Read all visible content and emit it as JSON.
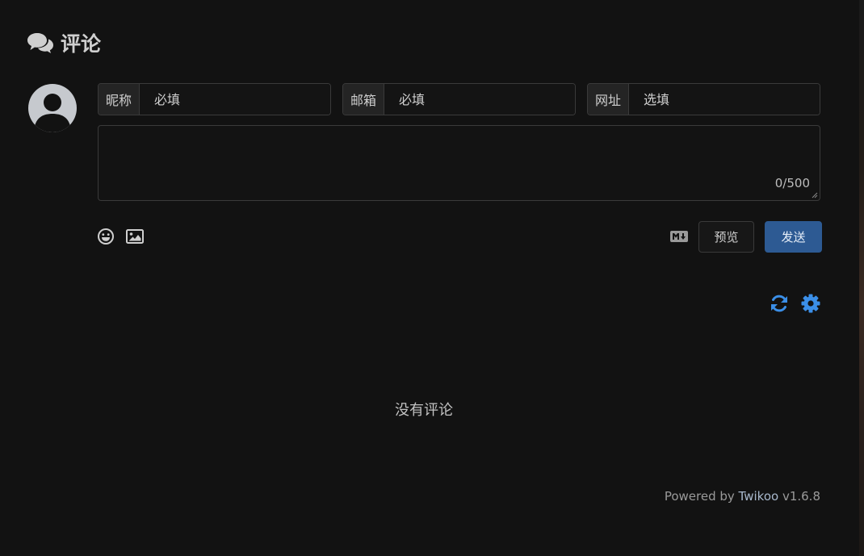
{
  "header": {
    "title": "评论",
    "icon": "comments-icon"
  },
  "form": {
    "nick": {
      "label": "昵称",
      "placeholder": "必填"
    },
    "mail": {
      "label": "邮箱",
      "placeholder": "必填"
    },
    "link": {
      "label": "网址",
      "placeholder": "选填"
    },
    "textarea": {
      "value": "",
      "counter": "0/500"
    },
    "tools": [
      "emoji-icon",
      "image-upload-icon"
    ],
    "markdown_icon": "markdown-icon",
    "preview_label": "预览",
    "send_label": "发送"
  },
  "actions": [
    "refresh-icon",
    "settings-icon"
  ],
  "comments": {
    "empty_text": "没有评论"
  },
  "footer": {
    "prefix": "Powered by",
    "link": "Twikoo",
    "version": "v1.6.8"
  },
  "colors": {
    "background": "#121212",
    "accent": "#2d5a93",
    "icon_blue": "#3b8fe8"
  }
}
